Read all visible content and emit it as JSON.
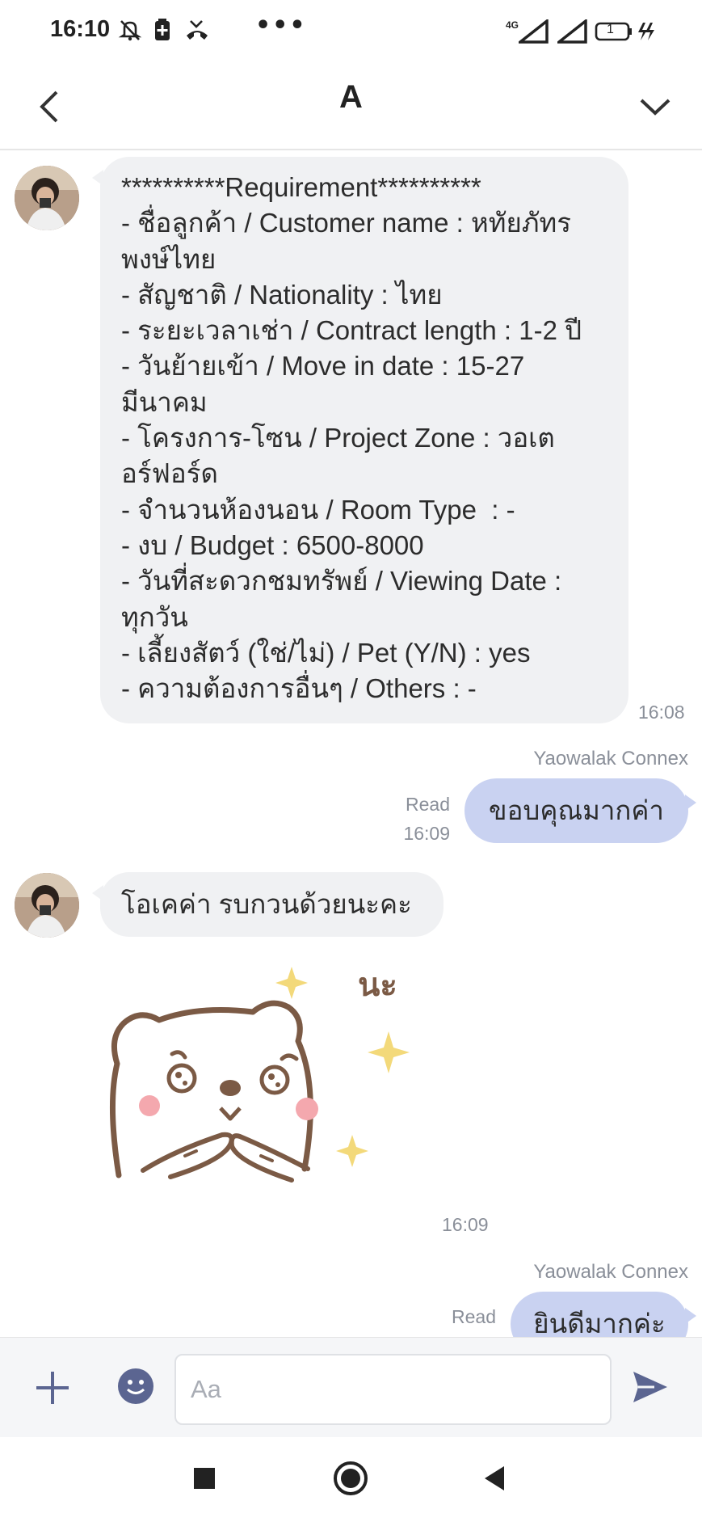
{
  "status_bar": {
    "time": "16:10",
    "network": "4G",
    "battery_level": "1",
    "icons": [
      "mute-icon",
      "battery-saver-icon",
      "missed-call-icon",
      "more-dots-icon",
      "signal-icon",
      "signal-icon",
      "battery-icon",
      "charging-icon"
    ]
  },
  "header": {
    "title": "A",
    "back_icon": "back-chevron-icon",
    "menu_icon": "chevron-down-icon"
  },
  "messages": [
    {
      "direction": "incoming",
      "lines": [
        "**********Requirement**********",
        "- ชื่อลูกค้า / Customer name : หทัยภัทร",
        "พงษ์ไทย",
        "- สัญชาติ / Nationality : ไทย",
        "- ระยะเวลาเช่า / Contract length : 1-2 ปี",
        "- วันย้ายเข้า / Move in date : 15-27",
        "มีนาคม",
        "- โครงการ-โซน / Project Zone : วอเต",
        "อร์ฟอร์ด",
        "- จำนวนห้องนอน / Room Type  : -",
        "- งบ / Budget : 6500-8000",
        "- วันที่สะดวกชมทรัพย์ / Viewing Date :",
        "ทุกวัน",
        "- เลี้ยงสัตว์ (ใช่/ไม่) / Pet (Y/N) : yes",
        "- ความต้องการอื่นๆ / Others : -"
      ],
      "time": "16:08"
    },
    {
      "direction": "outgoing",
      "sender": "Yaowalak Connex",
      "text": "ขอบคุณมากค่า",
      "read": "Read",
      "time": "16:09"
    },
    {
      "direction": "incoming",
      "text": "โอเคค่า รบกวนด้วยนะคะ"
    },
    {
      "direction": "incoming",
      "type": "sticker",
      "sticker_text": "นะ",
      "time": "16:09"
    },
    {
      "direction": "outgoing",
      "sender": "Yaowalak Connex",
      "text": "ยินดีมากค่ะ",
      "read": "Read"
    }
  ],
  "input_bar": {
    "placeholder": "Aa",
    "add_icon": "plus-icon",
    "emoji_icon": "emoji-icon",
    "send_icon": "send-icon"
  },
  "nav_bar": {
    "icons": [
      "recents-square-icon",
      "home-circle-icon",
      "back-triangle-icon"
    ]
  },
  "colors": {
    "incoming_bubble": "#f0f1f3",
    "outgoing_bubble": "#c9d2f1",
    "meta_text": "#8a8f99",
    "icon_accent": "#5b6591"
  }
}
